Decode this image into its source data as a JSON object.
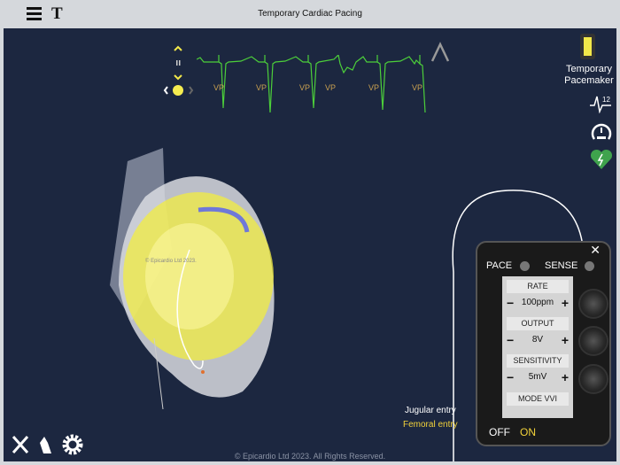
{
  "header": {
    "title": "Temporary Cardiac Pacing",
    "text_button": "T"
  },
  "ecg": {
    "labels": [
      "VP",
      "VP",
      "VP",
      "VP",
      "VP",
      "VP"
    ],
    "color": "#4ccf3a"
  },
  "sidebar": {
    "pacemaker_label": "Temporary Pacemaker",
    "icons": [
      "pacemaker-icon",
      "ecg-12-lead-icon",
      "gauge-icon",
      "defibrillator-heart-icon"
    ]
  },
  "heart": {
    "watermark": "© Epicardio Ltd 2023."
  },
  "pacemaker": {
    "pace_label": "PACE",
    "sense_label": "SENSE",
    "rate_label": "RATE",
    "rate_value": "100ppm",
    "output_label": "OUTPUT",
    "output_value": "8V",
    "sensitivity_label": "SENSITIVITY",
    "sensitivity_value": "5mV",
    "mode_label": "MODE VVI",
    "off_label": "OFF",
    "on_label": "ON",
    "minus": "−",
    "plus": "+",
    "close": "✕"
  },
  "entry": {
    "jugular": "Jugular entry",
    "femoral": "Femoral entry"
  },
  "footer": "© Epicardio Ltd 2023. All Rights Reserved.",
  "colors": {
    "accent": "#f2e84a",
    "background": "#1c2740"
  }
}
